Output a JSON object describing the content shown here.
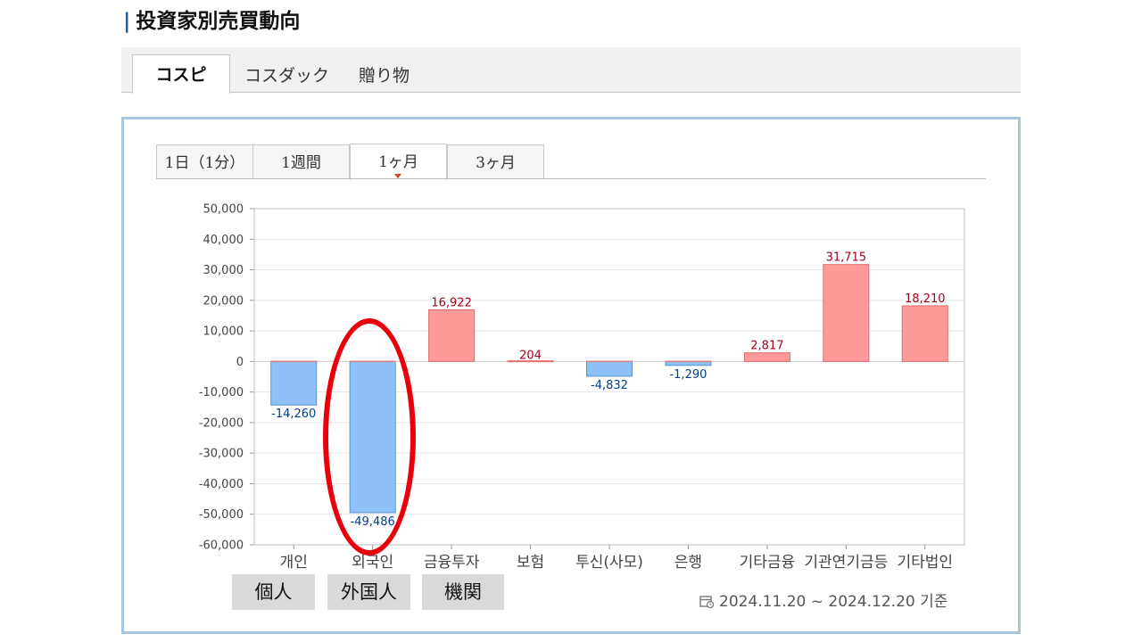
{
  "page": {
    "title": "投資家別売買動向"
  },
  "market_tabs": [
    {
      "label": "コスピ",
      "active": true
    },
    {
      "label": "コスダック",
      "active": false
    },
    {
      "label": "贈り物",
      "active": false
    }
  ],
  "period_tabs": [
    {
      "label": "1日（1分）",
      "active": false
    },
    {
      "label": "1週間",
      "active": false
    },
    {
      "label": "1ヶ月",
      "active": true
    },
    {
      "label": "3ヶ月",
      "active": false
    }
  ],
  "chart_data": {
    "type": "bar",
    "categories": [
      "개인",
      "외국인",
      "금융투자",
      "보험",
      "투신(사모)",
      "은행",
      "기타금융",
      "기관연기금등",
      "기타법인"
    ],
    "values": [
      -14260,
      -49486,
      16922,
      204,
      -4832,
      -1290,
      2817,
      31715,
      18210
    ],
    "value_labels": [
      "-14,260",
      "-49,486",
      "16,922",
      "204",
      "-4,832",
      "-1,290",
      "2,817",
      "31,715",
      "18,210"
    ],
    "ylim": [
      -60000,
      50000
    ],
    "yticks": [
      50000,
      40000,
      30000,
      20000,
      10000,
      0,
      -10000,
      -20000,
      -30000,
      -40000,
      -50000,
      -60000
    ],
    "ytick_labels": [
      "50,000",
      "40,000",
      "30,000",
      "20,000",
      "10,000",
      "0",
      "-10,000",
      "-20,000",
      "-30,000",
      "-40,000",
      "-50,000",
      "-60,000"
    ],
    "grid": true,
    "colors": {
      "positive_fill": "#ff9a9a",
      "positive_stroke": "#e46a6a",
      "negative_fill": "#8ec1f8",
      "negative_stroke": "#5b93d4",
      "positive_label": "#a3001a",
      "negative_label": "#003d8f",
      "highlight": "#e8000b"
    }
  },
  "annotations": {
    "jp_labels": [
      "個人",
      "外国人",
      "機関"
    ],
    "highlighted_category": "외국인"
  },
  "footer": {
    "date_range": "2024.11.20 ~ 2024.12.20 기준",
    "icon": "calendar-icon"
  }
}
